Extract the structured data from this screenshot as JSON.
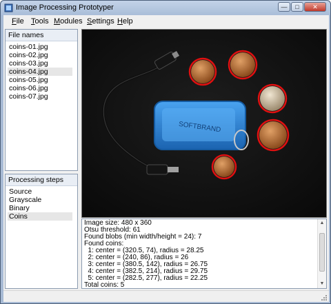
{
  "window": {
    "title": "Image Processing Prototyper"
  },
  "menu": [
    {
      "underline": "F",
      "rest": "ile"
    },
    {
      "underline": "T",
      "rest": "ools"
    },
    {
      "underline": "M",
      "rest": "odules"
    },
    {
      "underline": "S",
      "rest": "ettings"
    },
    {
      "underline": "H",
      "rest": "elp"
    }
  ],
  "files": {
    "header": "File names",
    "items": [
      "coins-01.jpg",
      "coins-02.jpg",
      "coins-03.jpg",
      "coins-04.jpg",
      "coins-05.jpg",
      "coins-06.jpg",
      "coins-07.jpg"
    ],
    "selected_index": 3
  },
  "steps": {
    "header": "Processing steps",
    "items": [
      "Source",
      "Grayscale",
      "Binary",
      "Coins"
    ],
    "selected_index": 3
  },
  "log": [
    "Image size: 480 x 360",
    "Otsu threshold: 61",
    "Found blobs (min width/height = 24): 7",
    "Found coins:",
    "  1: center = (320.5, 74), radius = 28.25",
    "  2: center = (240, 86), radius = 26",
    "  3: center = (380.5, 142), radius = 26.75",
    "  4: center = (382.5, 214), radius = 29.75",
    "  5: center = (282.5, 277), radius = 22.25",
    "Total coins: 5"
  ],
  "colors": {
    "detection_circle": "#e01010",
    "tag": "#2f86d6",
    "background": "#161616"
  },
  "icons": {
    "app": "app-icon",
    "minimize": "minimize-icon",
    "maximize": "maximize-icon",
    "close": "close-icon",
    "scroll_up": "arrow-up-icon",
    "scroll_down": "arrow-down-icon",
    "grip": "resize-grip-icon"
  }
}
